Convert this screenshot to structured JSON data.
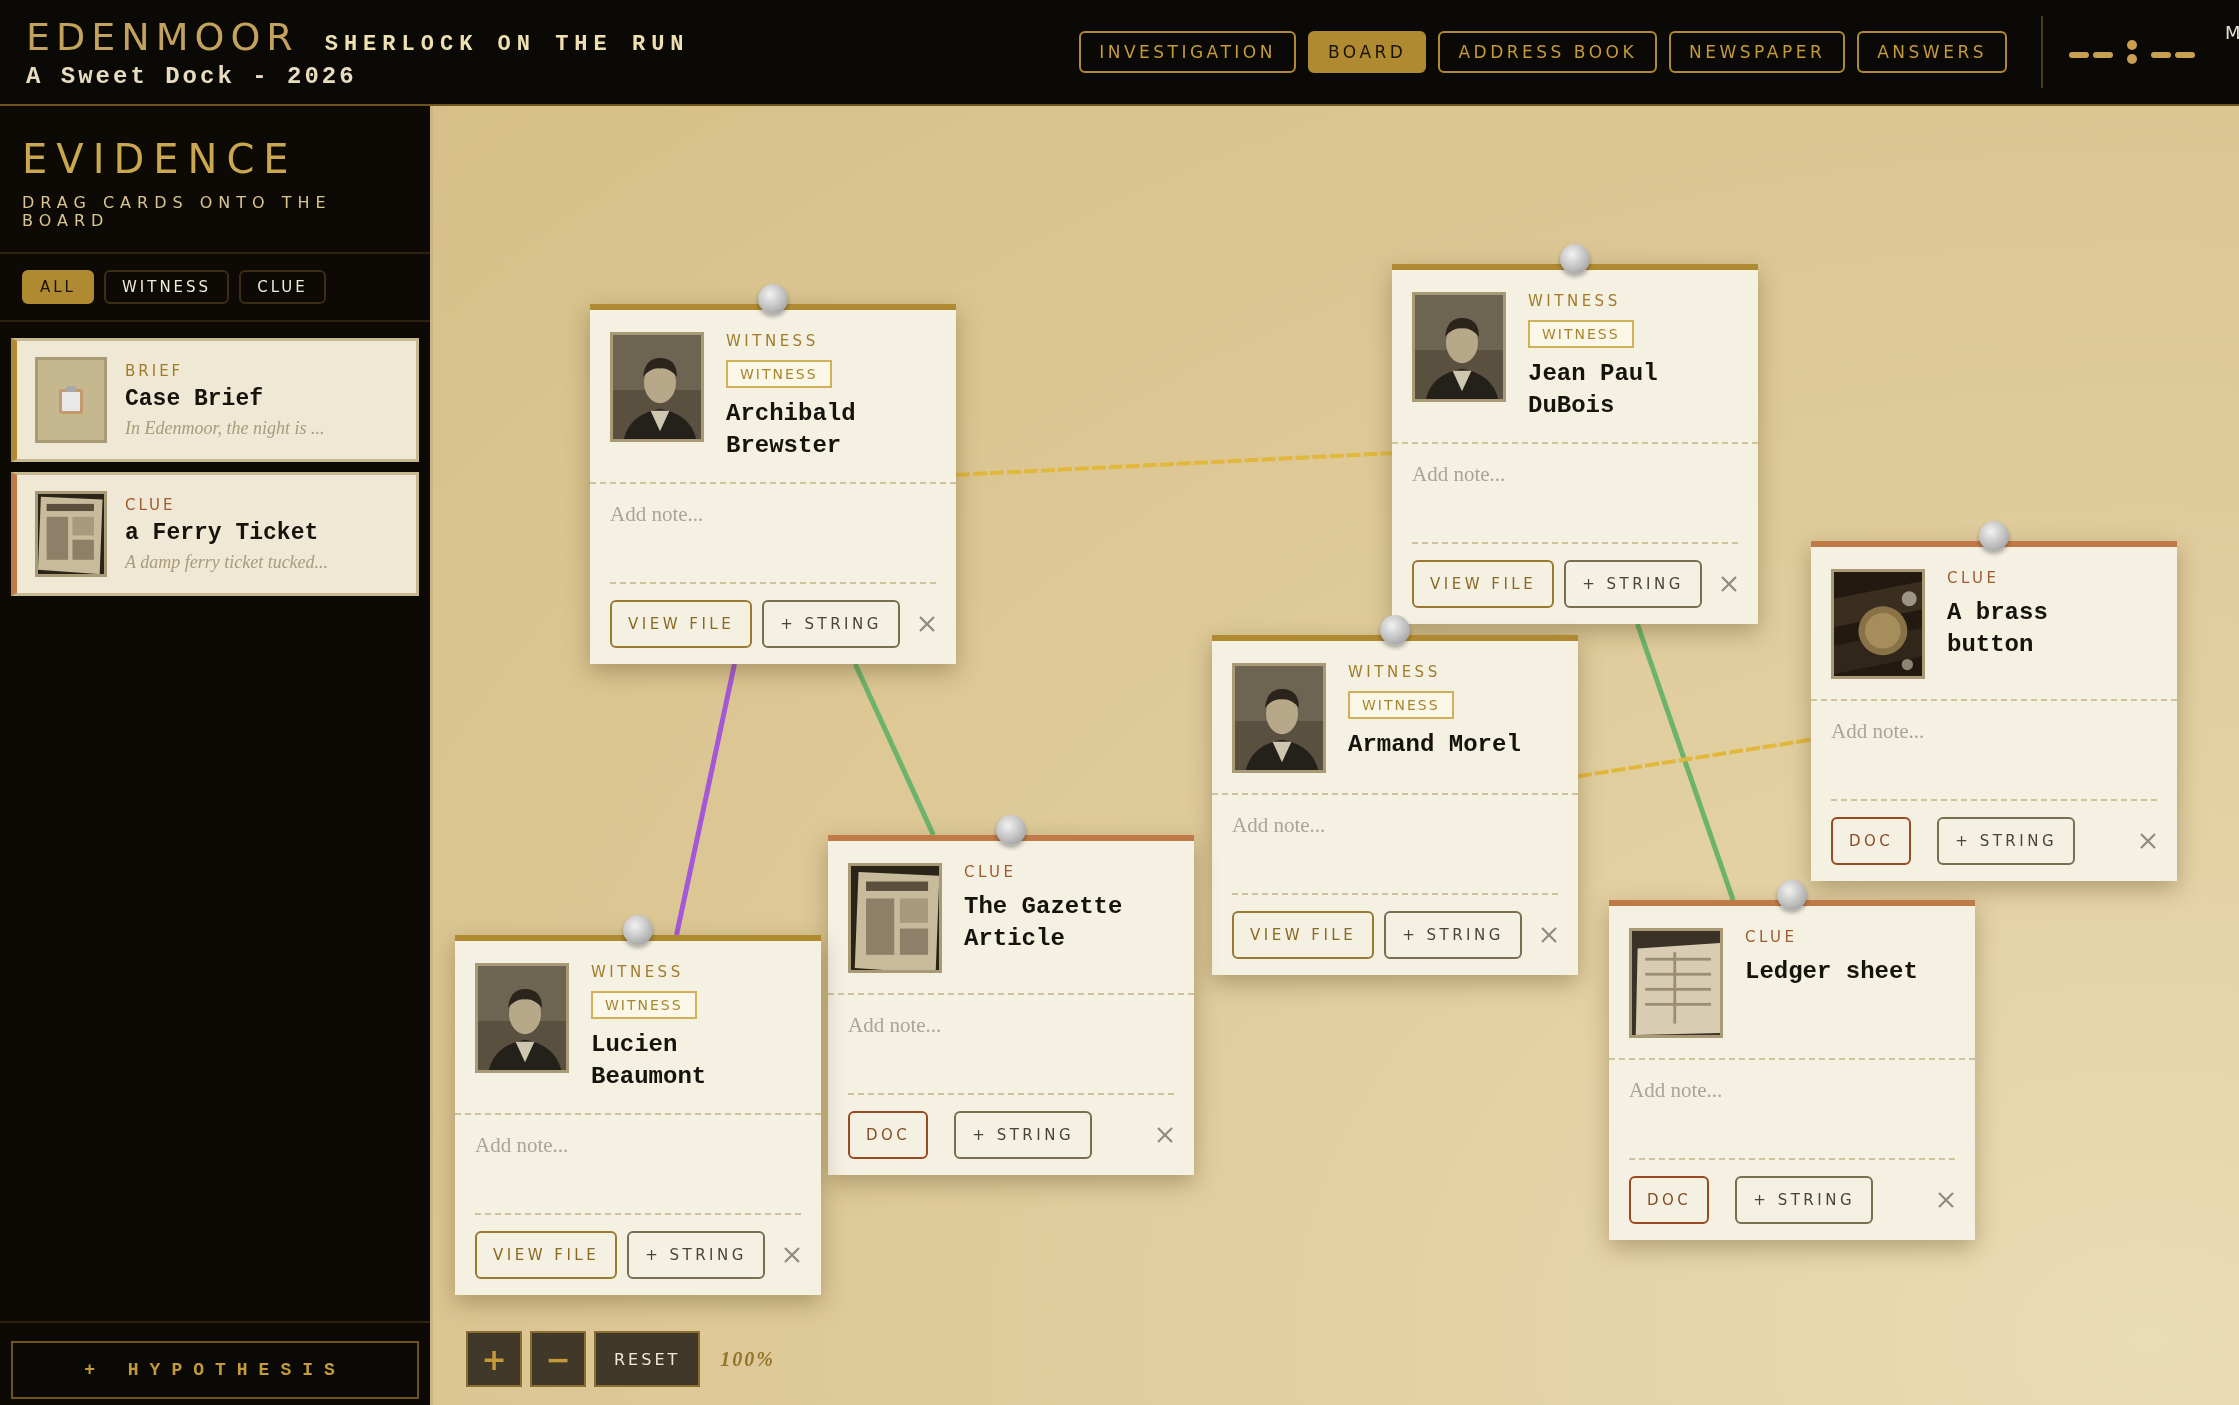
{
  "header": {
    "logo": "EDENMOOR",
    "title": "SHERLOCK ON THE RUN",
    "subtitle": "A Sweet Dock - 2026",
    "edge_text": "M"
  },
  "nav": {
    "tabs": [
      {
        "label": "INVESTIGATION",
        "selected": false
      },
      {
        "label": "BOARD",
        "selected": true
      },
      {
        "label": "ADDRESS BOOK",
        "selected": false
      },
      {
        "label": "NEWSPAPER",
        "selected": false
      },
      {
        "label": "ANSWERS",
        "selected": false
      }
    ]
  },
  "sidebar": {
    "title": "EVIDENCE",
    "subtitle": "DRAG CARDS ONTO THE BOARD",
    "filters": [
      {
        "label": "ALL",
        "selected": true
      },
      {
        "label": "WITNESS",
        "selected": false
      },
      {
        "label": "CLUE",
        "selected": false
      }
    ],
    "items": [
      {
        "kind": "brief",
        "category": "BRIEF",
        "title": "Case Brief",
        "excerpt": "In Edenmoor, the night is ..."
      },
      {
        "kind": "clue",
        "category": "CLUE",
        "title": "a Ferry Ticket",
        "excerpt": "A damp ferry ticket tucked..."
      }
    ],
    "hypothesis_button": "+ HYPOTHESIS"
  },
  "board": {
    "cards": [
      {
        "kind": "witness",
        "category": "WITNESS",
        "tag": "WITNESS",
        "name": "Archibald Brewster",
        "note_placeholder": "Add note...",
        "file_button": "VIEW FILE",
        "string_button": "+ STRING"
      },
      {
        "kind": "witness",
        "category": "WITNESS",
        "tag": "WITNESS",
        "name": "Jean Paul DuBois",
        "note_placeholder": "Add note...",
        "file_button": "VIEW FILE",
        "string_button": "+ STRING"
      },
      {
        "kind": "clue",
        "category": "CLUE",
        "name": "A brass button",
        "note_placeholder": "Add note...",
        "file_button": "DOC",
        "string_button": "+ STRING"
      },
      {
        "kind": "witness",
        "category": "WITNESS",
        "tag": "WITNESS",
        "name": "Armand Morel",
        "note_placeholder": "Add note...",
        "file_button": "VIEW FILE",
        "string_button": "+ STRING"
      },
      {
        "kind": "clue",
        "category": "CLUE",
        "name": "The Gazette Article",
        "note_placeholder": "Add note...",
        "file_button": "DOC",
        "string_button": "+ STRING"
      },
      {
        "kind": "witness",
        "category": "WITNESS",
        "tag": "WITNESS",
        "name": "Lucien Beaumont",
        "note_placeholder": "Add note...",
        "file_button": "VIEW FILE",
        "string_button": "+ STRING"
      },
      {
        "kind": "clue",
        "category": "CLUE",
        "name": "Ledger sheet",
        "note_placeholder": "Add note...",
        "file_button": "DOC",
        "string_button": "+ STRING"
      }
    ],
    "strings": [
      {
        "kind": "dashed",
        "color": "#e2b83c"
      },
      {
        "kind": "solid",
        "color": "#a458d8"
      },
      {
        "kind": "solid",
        "color": "#6cb46c"
      },
      {
        "kind": "solid",
        "color": "#6cb46c"
      },
      {
        "kind": "dashed",
        "color": "#e2b83c"
      }
    ],
    "zoom_controls": {
      "zoom_in": "+",
      "zoom_out": "−",
      "reset": "RESET",
      "level_text": "100%"
    }
  }
}
